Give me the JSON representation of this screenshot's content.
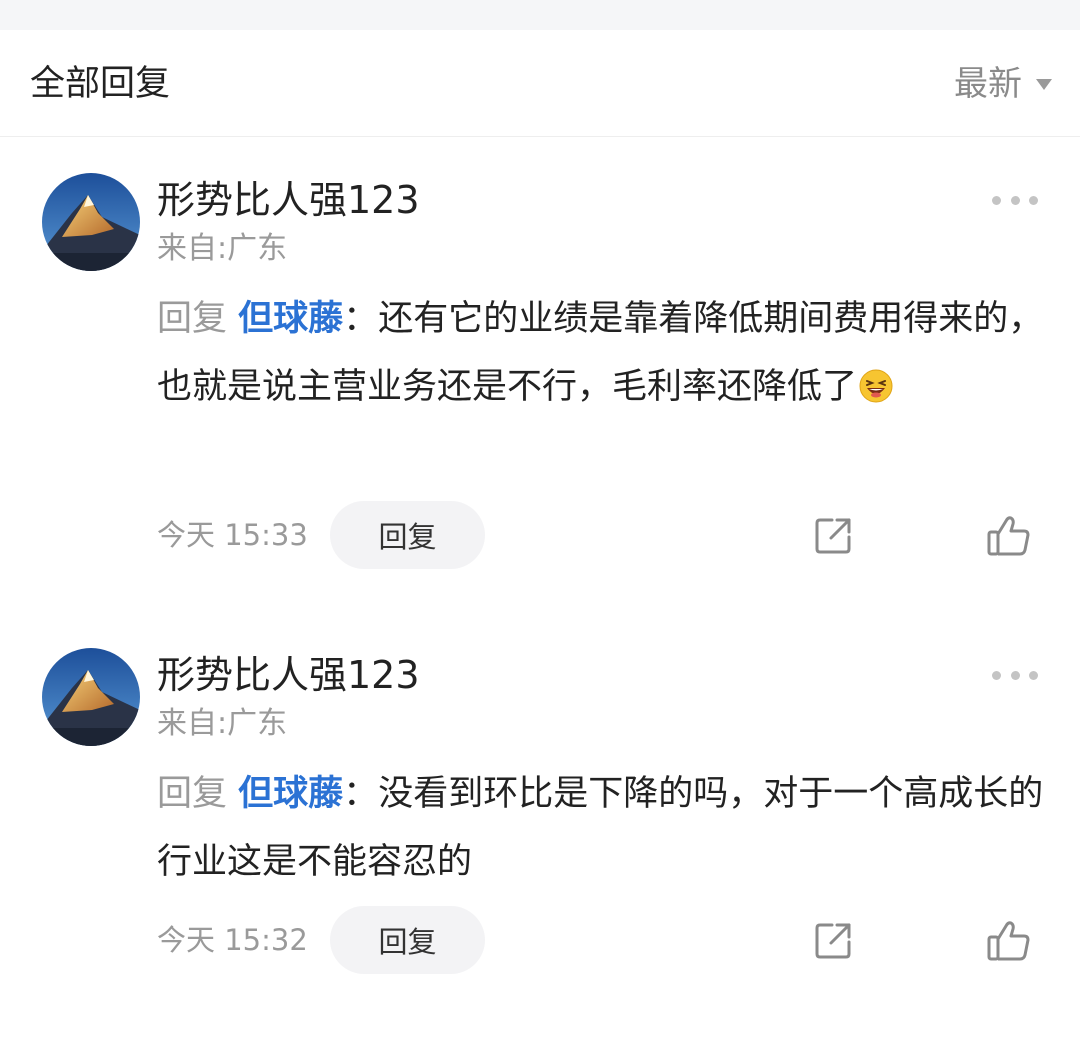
{
  "header": {
    "title": "全部回复",
    "sort_label": "最新"
  },
  "comments": [
    {
      "username": "形势比人强123",
      "location": "来自:广东",
      "reply_prefix": "回复",
      "mention": "但球藤",
      "separator": "：",
      "text": "还有它的业绩是靠着降低期间费用得来的，也就是说主营业务还是不行，毛利率还降低了",
      "emoji": "laughing-emoji",
      "time": "今天 15:33",
      "reply_label": "回复"
    },
    {
      "username": "形势比人强123",
      "location": "来自:广东",
      "reply_prefix": "回复",
      "mention": "但球藤",
      "separator": "：",
      "text": "没看到环比是下降的吗，对于一个高成长的行业这是不能容忍的",
      "time": "今天 15:32",
      "reply_label": "回复"
    }
  ],
  "icons": {
    "more": "more-dots-icon",
    "share": "share-icon",
    "like": "thumbs-up-icon",
    "sort": "caret-down-icon"
  },
  "colors": {
    "mention": "#2b72d4",
    "secondary_text": "#9a9a9a",
    "reply_button_bg": "#f3f3f5"
  }
}
